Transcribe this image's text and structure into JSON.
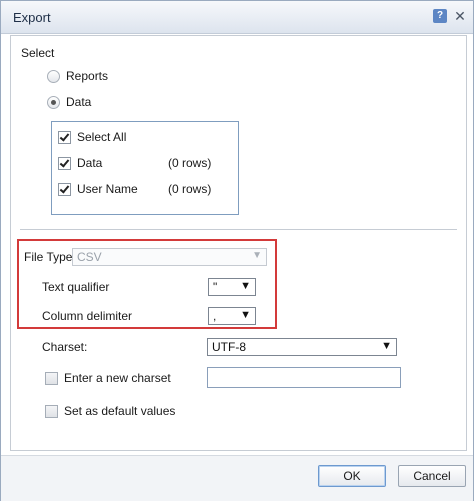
{
  "window": {
    "title": "Export",
    "help_icon": "help-icon",
    "close_icon": "close-icon"
  },
  "select_section": {
    "heading": "Select",
    "options": [
      {
        "label": "Reports",
        "selected": false
      },
      {
        "label": "Data",
        "selected": true
      }
    ],
    "data_items": {
      "select_all": {
        "label": "Select All",
        "checked": true
      },
      "rows": [
        {
          "label": "Data",
          "count": "(0 rows)",
          "checked": true
        },
        {
          "label": "User Name",
          "count": "(0 rows)",
          "checked": true
        }
      ]
    }
  },
  "format": {
    "file_type": {
      "label": "File Type:",
      "value": "CSV"
    },
    "text_qualifier": {
      "label": "Text qualifier",
      "value": "\""
    },
    "column_delimiter": {
      "label": "Column delimiter",
      "value": ","
    },
    "charset": {
      "label": "Charset:",
      "value": "UTF-8"
    },
    "new_charset": {
      "label": "Enter a new charset",
      "checked": false,
      "value": ""
    },
    "default_values": {
      "label": "Set as default values",
      "checked": false
    }
  },
  "footer": {
    "ok_label": "OK",
    "cancel_label": "Cancel"
  },
  "colors": {
    "highlight_border": "#d33a3a",
    "accent_border": "#7f9dbf"
  }
}
